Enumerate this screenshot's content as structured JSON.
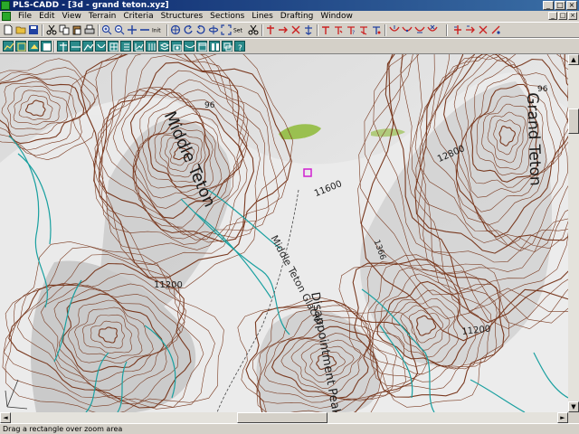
{
  "window": {
    "title": "PLS-CADD - [3d - grand teton.xyz]",
    "minimize_glyph": "_",
    "maximize_glyph": "□",
    "close_glyph": "×"
  },
  "menu": {
    "items": [
      "File",
      "Edit",
      "View",
      "Terrain",
      "Criteria",
      "Structures",
      "Sections",
      "Lines",
      "Drafting",
      "Window"
    ]
  },
  "toolbar": {
    "init_label": "Init",
    "set_label": "Set"
  },
  "map": {
    "labels": [
      {
        "id": "middle-teton",
        "text": "Middle Teton"
      },
      {
        "id": "grand-teton",
        "text": "Grand Teton"
      },
      {
        "id": "middle-teton-glacier",
        "text": "Middle Teton Glacier"
      },
      {
        "id": "disappointment-peak",
        "text": "Disappointment Peak"
      },
      {
        "id": "elev-11600",
        "text": "11600"
      },
      {
        "id": "elev-12800",
        "text": "12800"
      },
      {
        "id": "elev-11200-left",
        "text": "11200"
      },
      {
        "id": "elev-11200-right",
        "text": "11200"
      },
      {
        "id": "elev-96-left",
        "text": "96"
      },
      {
        "id": "elev-96-right",
        "text": "96"
      },
      {
        "id": "elev-1366",
        "text": "1366"
      }
    ]
  },
  "scrollbar": {
    "up": "▲",
    "down": "▼",
    "left": "◄",
    "right": "►"
  },
  "status": {
    "text": "Drag a rectangle over zoom area"
  },
  "colors": {
    "contour_brown": "#7a3a20",
    "water_cyan": "#1aa0a0",
    "accent_red": "#cc2020",
    "accent_blue": "#2040a0",
    "selection_magenta": "#d020d0",
    "vegetation_green": "#9ac050"
  }
}
